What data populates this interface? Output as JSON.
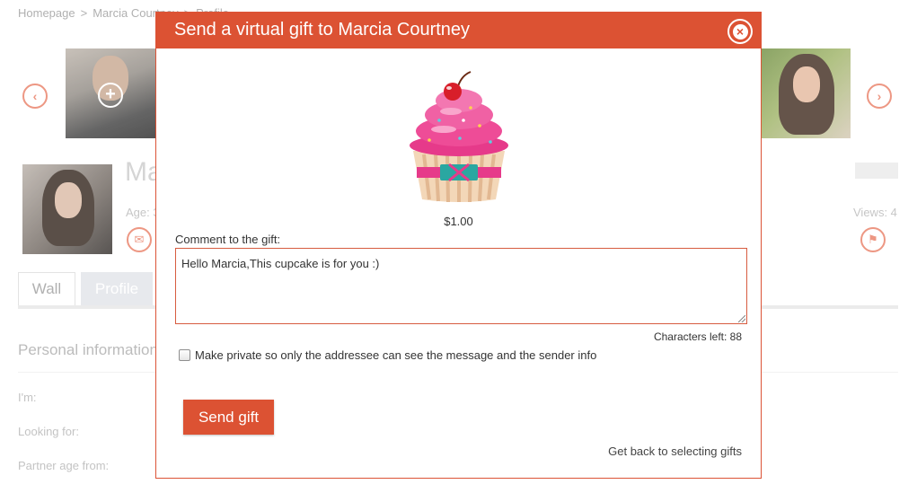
{
  "background": {
    "breadcrumbs": [
      "Homepage",
      ">",
      "Marcia Courtney",
      ">",
      "Profile"
    ],
    "profile_name": "Marcia Courtney",
    "age_label": "Age: 3",
    "views_label": "Views: 4",
    "tabs": [
      {
        "label": "Wall"
      },
      {
        "label": "Profile"
      }
    ],
    "section_title": "Personal information",
    "fields": {
      "im": "I'm:",
      "looking_for": "Looking for:",
      "partner_age": "Partner age from:"
    },
    "icons": {
      "prev": "chevron-left-icon",
      "next": "chevron-right-icon",
      "add_photo": "plus-icon",
      "message": "envelope-icon",
      "report": "flag-icon"
    }
  },
  "modal": {
    "title": "Send a virtual gift to Marcia Courtney",
    "close_icon": "close-icon",
    "gift": {
      "icon": "cupcake-icon",
      "price": "$1.00"
    },
    "comment_label": "Comment to the gift:",
    "comment_value": "Hello Marcia,This cupcake is for you :)",
    "chars_left": "Characters left: 88",
    "private_checked": false,
    "private_label": "Make private so only the addressee can see the message and the sender info",
    "send_button": "Send gift",
    "back_link": "Get back to selecting gifts"
  },
  "colors": {
    "accent": "#dc5233",
    "icon_outline": "#e87a60",
    "cupcake_frosting": "#e63a8a",
    "cupcake_cherry": "#d81e2a",
    "cupcake_wrapper": "#f3d7b8",
    "cupcake_ribbon": "#2aa7a1"
  }
}
